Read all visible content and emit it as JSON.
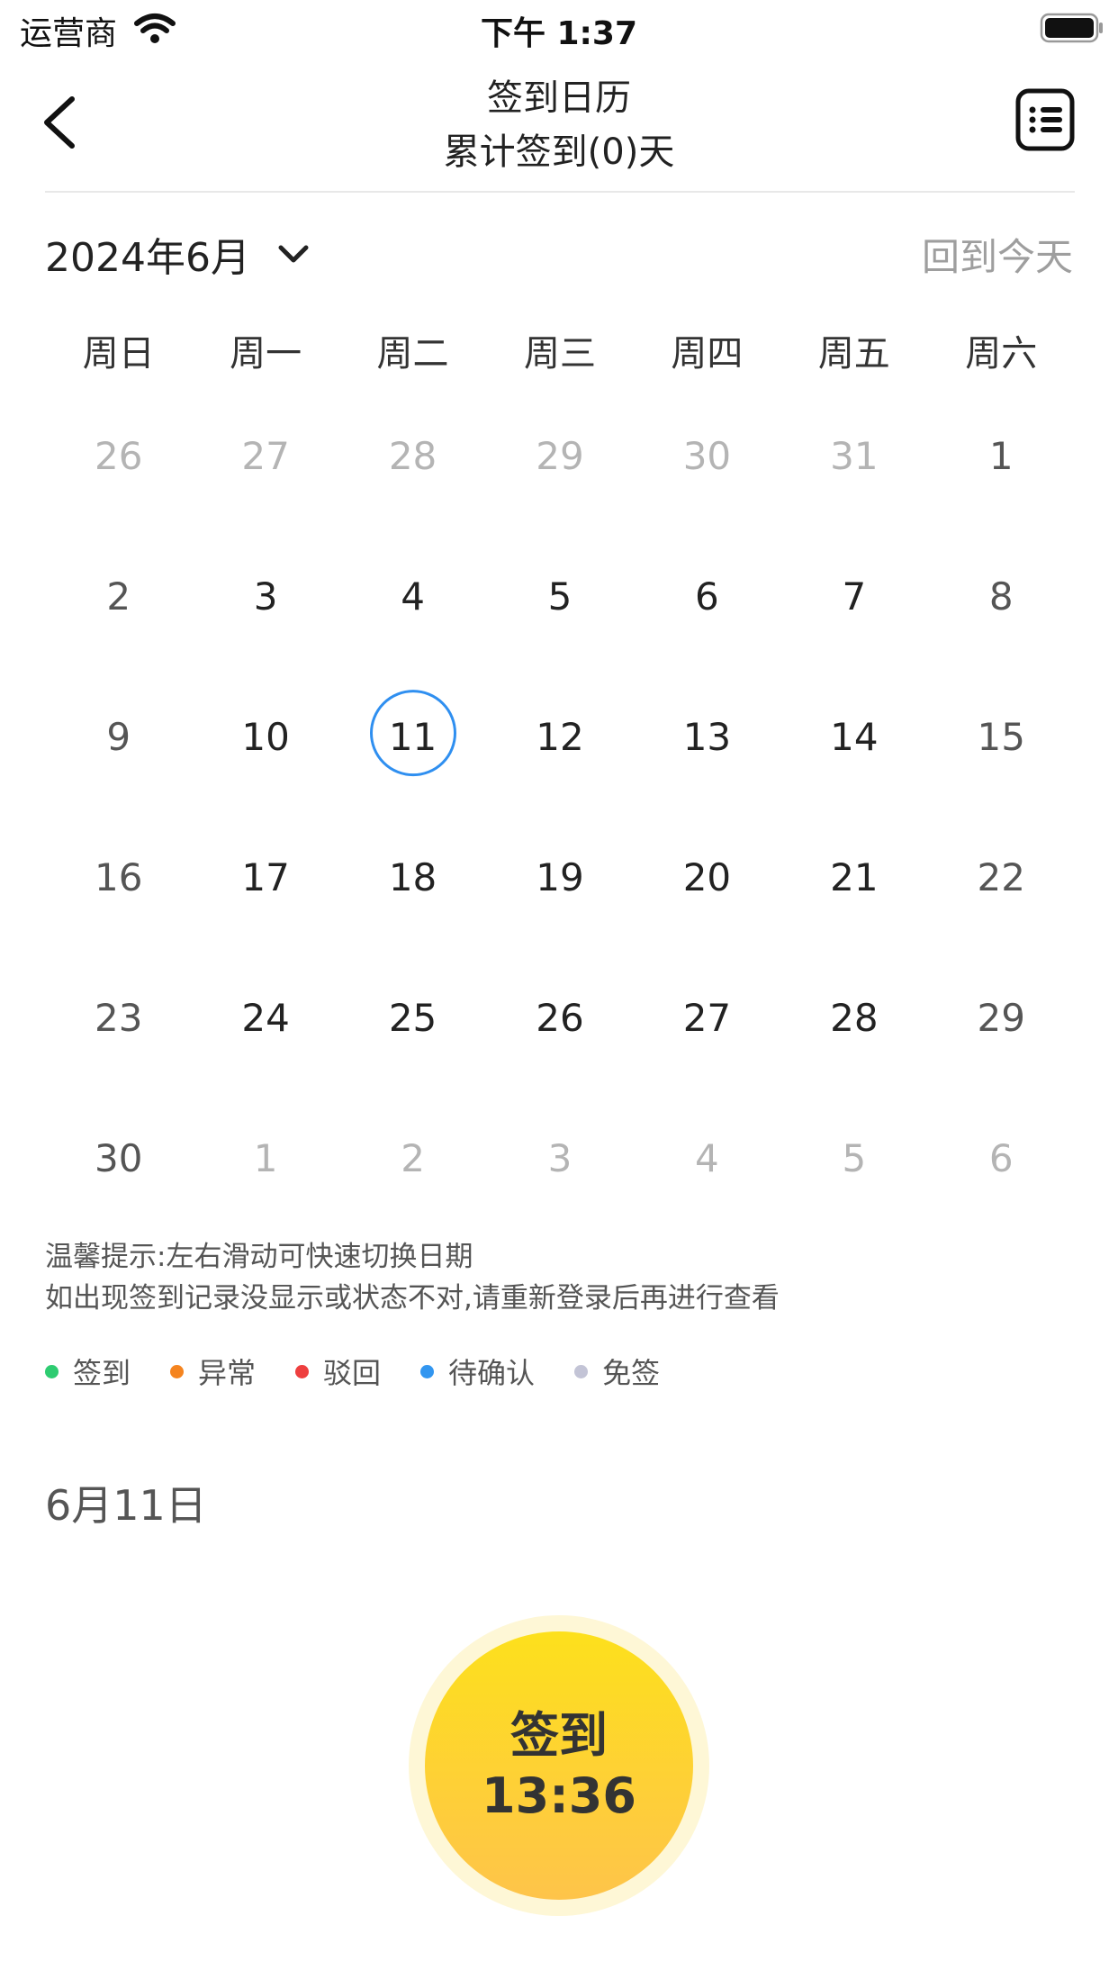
{
  "status_bar": {
    "carrier": "运营商",
    "time": "下午 1:37"
  },
  "header": {
    "title": "签到日历",
    "subtitle": "累计签到(0)天"
  },
  "calendar": {
    "month_label": "2024年6月",
    "today_button": "回到今天",
    "weekdays": [
      "周日",
      "周一",
      "周二",
      "周三",
      "周四",
      "周五",
      "周六"
    ],
    "days": [
      {
        "n": "26",
        "other": true
      },
      {
        "n": "27",
        "other": true
      },
      {
        "n": "28",
        "other": true
      },
      {
        "n": "29",
        "other": true
      },
      {
        "n": "30",
        "other": true
      },
      {
        "n": "31",
        "other": true
      },
      {
        "n": "1"
      },
      {
        "n": "2"
      },
      {
        "n": "3"
      },
      {
        "n": "4"
      },
      {
        "n": "5"
      },
      {
        "n": "6"
      },
      {
        "n": "7"
      },
      {
        "n": "8"
      },
      {
        "n": "9"
      },
      {
        "n": "10"
      },
      {
        "n": "11",
        "today": true
      },
      {
        "n": "12"
      },
      {
        "n": "13"
      },
      {
        "n": "14"
      },
      {
        "n": "15"
      },
      {
        "n": "16"
      },
      {
        "n": "17"
      },
      {
        "n": "18"
      },
      {
        "n": "19"
      },
      {
        "n": "20"
      },
      {
        "n": "21"
      },
      {
        "n": "22"
      },
      {
        "n": "23"
      },
      {
        "n": "24"
      },
      {
        "n": "25"
      },
      {
        "n": "26"
      },
      {
        "n": "27"
      },
      {
        "n": "28"
      },
      {
        "n": "29"
      },
      {
        "n": "30"
      },
      {
        "n": "1",
        "other": true
      },
      {
        "n": "2",
        "other": true
      },
      {
        "n": "3",
        "other": true
      },
      {
        "n": "4",
        "other": true
      },
      {
        "n": "5",
        "other": true
      },
      {
        "n": "6",
        "other": true
      }
    ]
  },
  "tips": {
    "line1": "温馨提示:左右滑动可快速切换日期",
    "line2": "如出现签到记录没显示或状态不对,请重新登录后再进行查看"
  },
  "legend": [
    {
      "label": "签到",
      "color": "#2ecc71"
    },
    {
      "label": "异常",
      "color": "#f5841f"
    },
    {
      "label": "驳回",
      "color": "#ee3f3f"
    },
    {
      "label": "待确认",
      "color": "#3296f0"
    },
    {
      "label": "免签",
      "color": "#c3c4d6"
    }
  ],
  "selected_date": "6月11日",
  "checkin": {
    "label": "签到",
    "time": "13:36"
  }
}
